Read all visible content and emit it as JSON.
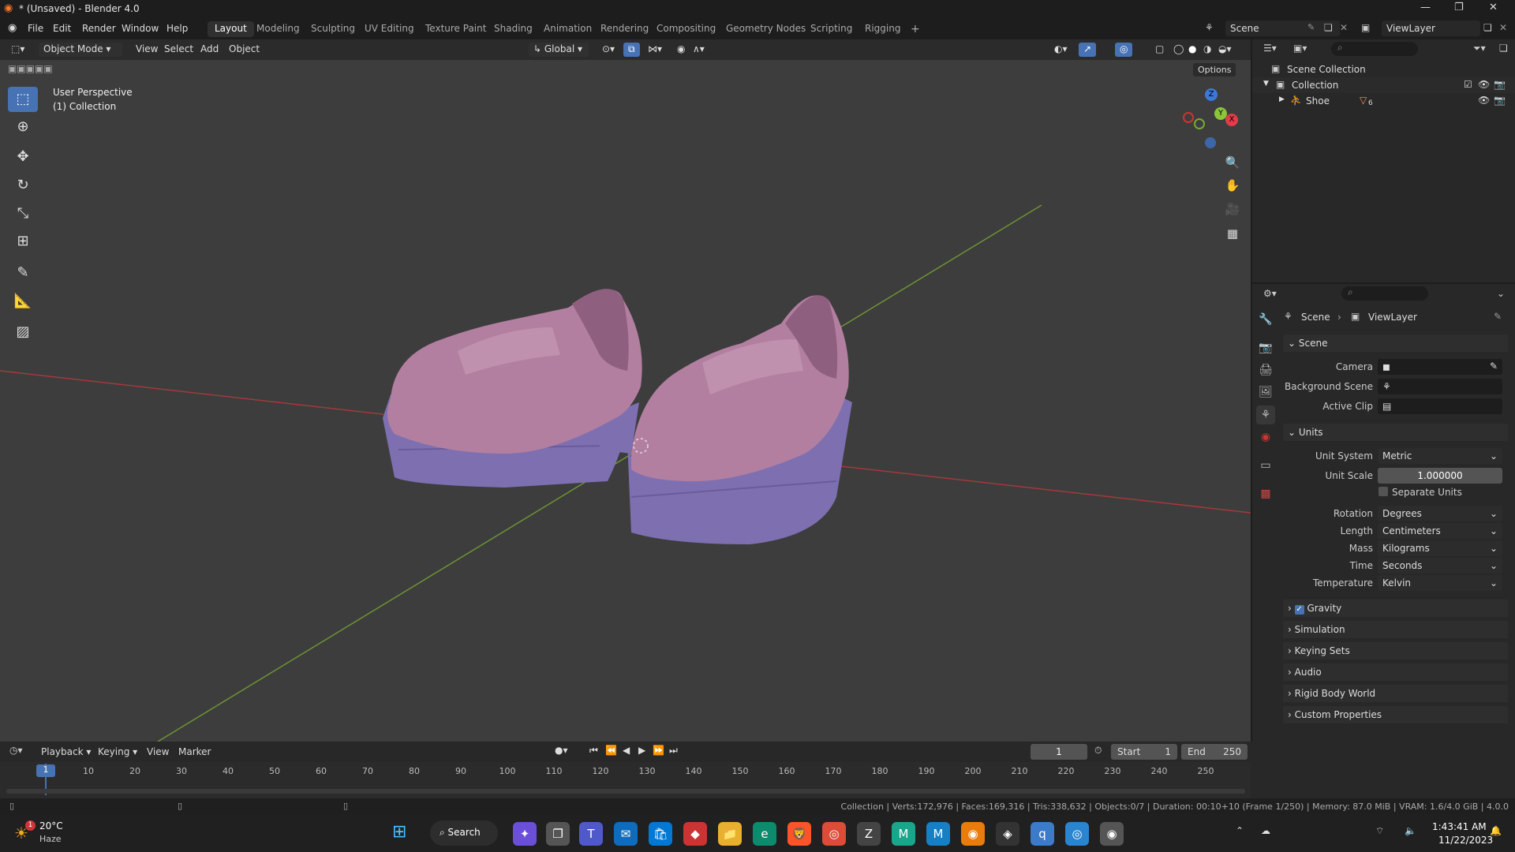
{
  "window": {
    "title": "* (Unsaved) - Blender 4.0"
  },
  "menus": [
    "File",
    "Edit",
    "Render",
    "Window",
    "Help"
  ],
  "workspaces": [
    "Layout",
    "Modeling",
    "Sculpting",
    "UV Editing",
    "Texture Paint",
    "Shading",
    "Animation",
    "Rendering",
    "Compositing",
    "Geometry Nodes",
    "Scripting",
    "Rigging"
  ],
  "active_workspace": "Layout",
  "scene_field": "Scene",
  "viewlayer_field": "ViewLayer",
  "viewport": {
    "mode": "Object Mode",
    "menus": [
      "View",
      "Select",
      "Add",
      "Object"
    ],
    "orientation": "Global",
    "options": "Options",
    "overlay_title": "User Perspective",
    "overlay_collection": "(1) Collection",
    "gizmo": {
      "x": "X",
      "y": "Y",
      "z": "Z"
    }
  },
  "outliner": {
    "rows": [
      {
        "label": "Scene Collection"
      },
      {
        "label": "Collection"
      },
      {
        "label": "Shoe",
        "badge": "6"
      }
    ]
  },
  "properties": {
    "breadcrumb": [
      "Scene",
      "ViewLayer"
    ],
    "scene_section": "Scene",
    "camera_label": "Camera",
    "background_label": "Background Scene",
    "clip_label": "Active Clip",
    "units_section": "Units",
    "unit_system_label": "Unit System",
    "unit_system": "Metric",
    "unit_scale_label": "Unit Scale",
    "unit_scale": "1.000000",
    "separate_units": "Separate Units",
    "rotation_label": "Rotation",
    "rotation": "Degrees",
    "length_label": "Length",
    "length": "Centimeters",
    "mass_label": "Mass",
    "mass": "Kilograms",
    "time_label": "Time",
    "time": "Seconds",
    "temperature_label": "Temperature",
    "temperature": "Kelvin",
    "collapsed": [
      "Gravity",
      "Simulation",
      "Keying Sets",
      "Audio",
      "Rigid Body World",
      "Custom Properties"
    ]
  },
  "timeline": {
    "menus": [
      "Playback",
      "Keying",
      "View",
      "Marker"
    ],
    "current": "1",
    "start_label": "Start",
    "start": "1",
    "end_label": "End",
    "end": "250",
    "ticks": [
      "10",
      "20",
      "30",
      "40",
      "50",
      "60",
      "70",
      "80",
      "90",
      "100",
      "110",
      "120",
      "130",
      "140",
      "150",
      "160",
      "170",
      "180",
      "190",
      "200",
      "210",
      "220",
      "230",
      "240",
      "250"
    ]
  },
  "status": {
    "text": "Collection | Verts:172,976 | Faces:169,316 | Tris:338,632 | Objects:0/7 | Duration: 00:10+10 (Frame 1/250) | Memory: 87.0 MiB | VRAM: 1.6/4.0 GiB | 4.0.0"
  },
  "taskbar": {
    "temp": "20°C",
    "weather": "Haze",
    "search": "Search",
    "time": "1:43:41 AM",
    "date": "11/22/2023",
    "weather_badge": "1"
  },
  "colors": {
    "accent": "#4772b3",
    "shoe_upper": "#b37fa0",
    "shoe_sole": "#7e70b0",
    "viewport": "#3d3d3d",
    "x_axis": "#a4393b",
    "y_axis": "#6c9433"
  }
}
